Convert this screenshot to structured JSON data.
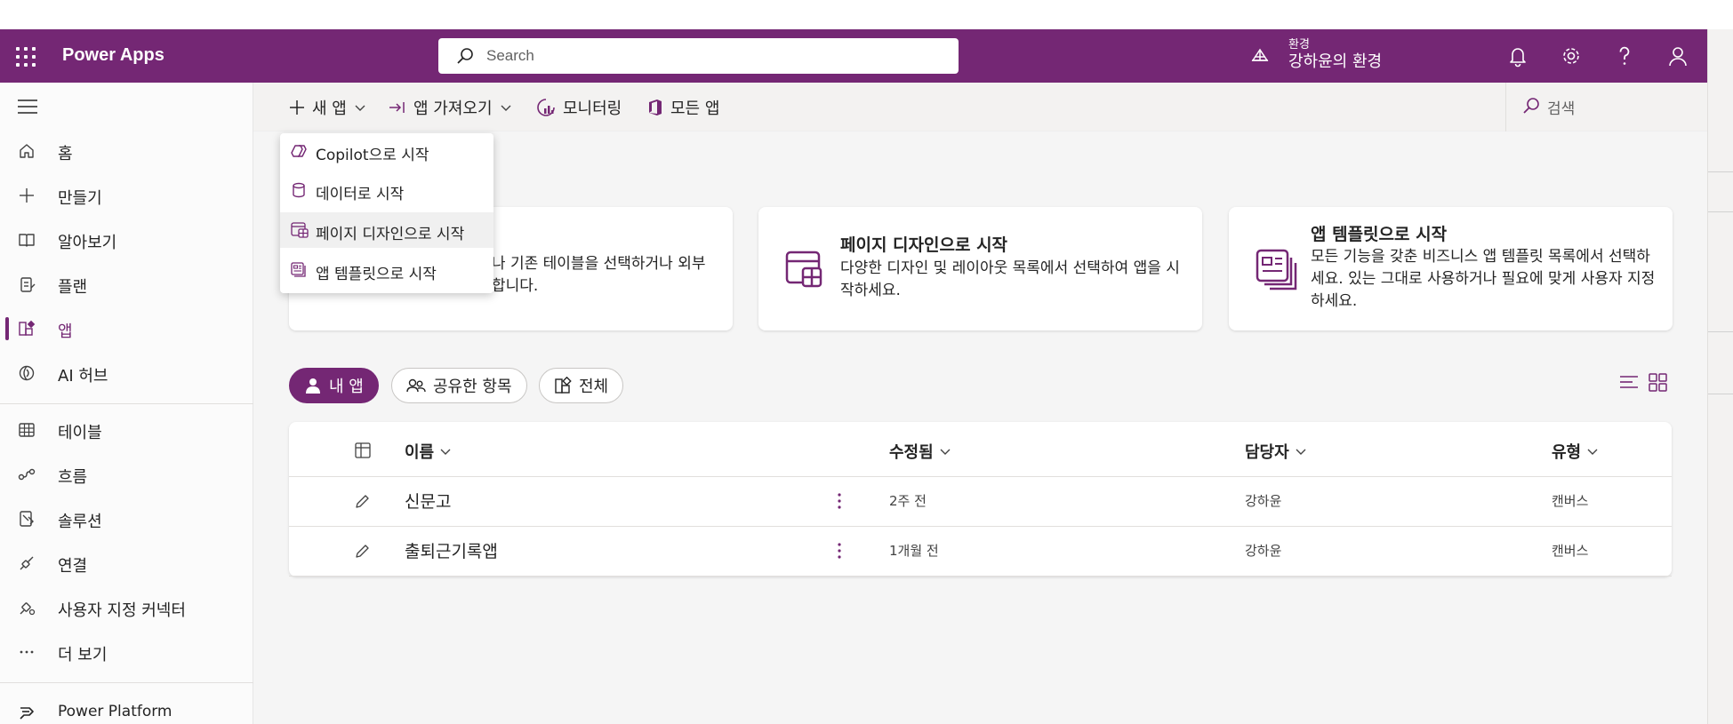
{
  "header": {
    "app_title": "Power Apps",
    "search_placeholder": "Search",
    "env_label": "환경",
    "env_name": "강하윤의 환경"
  },
  "sidebar": {
    "items": [
      {
        "label": "홈",
        "icon": "home-icon"
      },
      {
        "label": "만들기",
        "icon": "plus-icon"
      },
      {
        "label": "알아보기",
        "icon": "book-icon"
      },
      {
        "label": "플랜",
        "icon": "plan-icon"
      },
      {
        "label": "앱",
        "icon": "apps-icon",
        "active": true
      },
      {
        "label": "AI 허브",
        "icon": "ai-hub-icon"
      },
      {
        "label": "테이블",
        "icon": "table-icon"
      },
      {
        "label": "흐름",
        "icon": "flow-icon"
      },
      {
        "label": "솔루션",
        "icon": "solution-icon"
      },
      {
        "label": "연결",
        "icon": "connection-icon"
      },
      {
        "label": "사용자 지정 커넥터",
        "icon": "connector-icon"
      },
      {
        "label": "더 보기",
        "icon": "more-icon"
      },
      {
        "label": "Power Platform",
        "icon": "power-platform-icon"
      }
    ]
  },
  "commandbar": {
    "new_app": "새 앱",
    "import_app": "앱 가져오기",
    "monitoring": "모니터링",
    "all_apps": "모든 앱",
    "search_placeholder": "검색"
  },
  "dropdown": {
    "items": [
      "Copilot으로 시작",
      "데이터로 시작",
      "페이지 디자인으로 시작",
      "앱 템플릿으로 시작"
    ]
  },
  "cards": [
    {
      "title": "",
      "desc": "새 테이블을 만들거나 기존 테이블을 선택하거나 외부 데이터 소스에 연결합니다."
    },
    {
      "title": "페이지 디자인으로 시작",
      "desc": "다양한 디자인 및 레이아웃 목록에서 선택하여 앱을 시작하세요."
    },
    {
      "title": "앱 템플릿으로 시작",
      "desc": "모든 기능을 갖춘 비즈니스 앱 템플릿 목록에서 선택하세요. 있는 그대로 사용하거나 필요에 맞게 사용자 지정하세요."
    }
  ],
  "filters": {
    "my_apps": "내 앱",
    "shared": "공유한 항목",
    "all": "전체"
  },
  "table": {
    "headers": {
      "name": "이름",
      "modified": "수정됨",
      "owner": "담당자",
      "type": "유형"
    },
    "rows": [
      {
        "name": "신문고",
        "modified": "2주 전",
        "owner": "강하윤",
        "type": "캔버스"
      },
      {
        "name": "출퇴근기록앱",
        "modified": "1개월 전",
        "owner": "강하윤",
        "type": "캔버스"
      }
    ]
  },
  "colors": {
    "brand": "#742774",
    "background": "#f5f5f5"
  }
}
